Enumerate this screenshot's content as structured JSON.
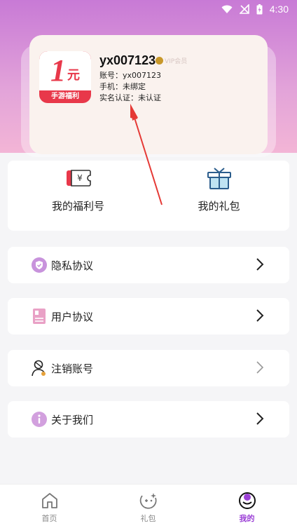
{
  "status_bar": {
    "time": "4:30"
  },
  "profile": {
    "logo_big": "1",
    "logo_small": "元",
    "logo_caption": "手游福利",
    "username": "yx007123",
    "vip_label": "VIP会员",
    "account_line": "账号：yx007123",
    "phone_line": "手机：未绑定",
    "realname_line": "实名认证：未认证"
  },
  "quick_actions": [
    {
      "label": "我的福利号",
      "icon": "ticket-icon"
    },
    {
      "label": "我的礼包",
      "icon": "gift-icon"
    }
  ],
  "menu": [
    {
      "label": "隐私协议",
      "icon": "shield-icon"
    },
    {
      "label": "用户协议",
      "icon": "document-icon"
    },
    {
      "label": "注销账号",
      "icon": "user-remove-icon"
    },
    {
      "label": "关于我们",
      "icon": "info-icon"
    }
  ],
  "bottom_nav": [
    {
      "label": "首页",
      "icon": "home-icon"
    },
    {
      "label": "礼包",
      "icon": "gamepad-icon"
    },
    {
      "label": "我的",
      "icon": "profile-icon",
      "active": true
    }
  ],
  "colors": {
    "accent": "#9b3fd6",
    "brand_red": "#e8384a",
    "hero_top": "#c87ad6",
    "hero_bottom": "#f3b5d6",
    "annotation_red": "#e53935"
  }
}
